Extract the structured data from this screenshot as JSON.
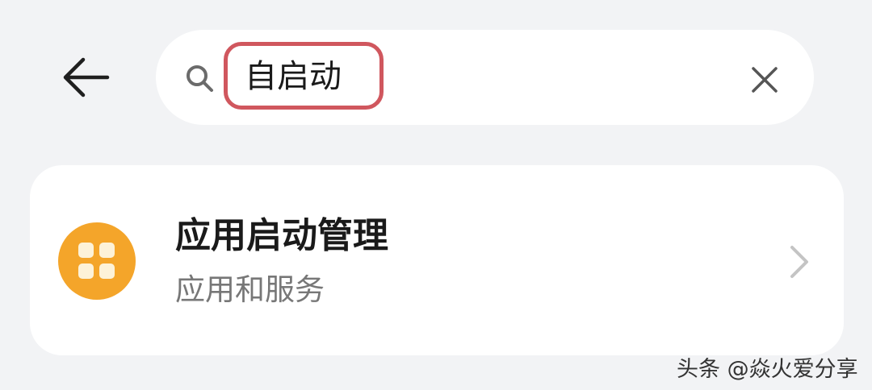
{
  "header": {
    "back_icon": "arrow-left-icon"
  },
  "search": {
    "icon": "search-icon",
    "value": "自启动",
    "highlight_color": "#d0575e",
    "clear_icon": "close-icon"
  },
  "results": [
    {
      "title": "应用启动管理",
      "subtitle": "应用和服务",
      "icon": "app-grid-icon",
      "icon_color": "#f4a52a",
      "chevron": "chevron-right-icon"
    }
  ],
  "watermark": {
    "text": "头条 @焱火爱分享"
  }
}
